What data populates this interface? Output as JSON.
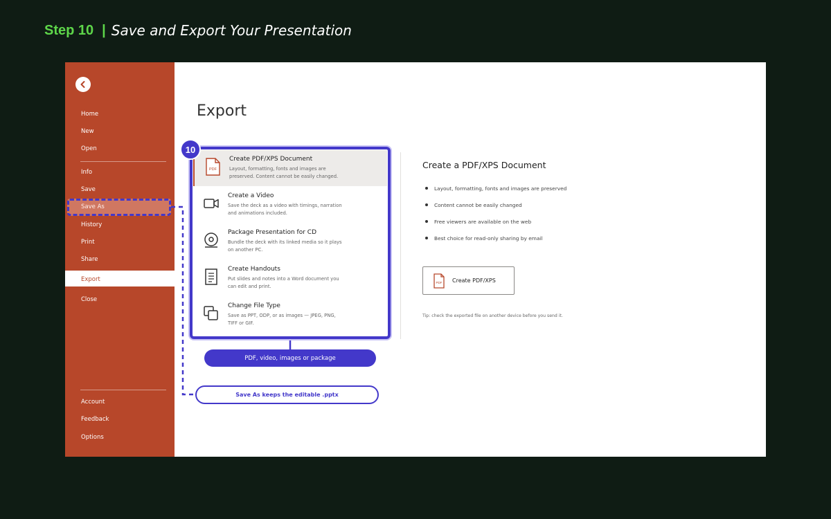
{
  "header": {
    "step_label": "Step 10",
    "separator": "|",
    "title": "Save and Export Your Presentation"
  },
  "sidebar": {
    "items_top": [
      "Home",
      "New",
      "Open"
    ],
    "items_mid": [
      "Info",
      "Save",
      "Save As",
      "History",
      "Print",
      "Share",
      "Export",
      "Close"
    ],
    "items_bottom": [
      "Account",
      "Feedback",
      "Options"
    ],
    "active": "Export"
  },
  "main": {
    "page_title": "Export",
    "options": [
      {
        "title": "Create PDF/XPS Document",
        "desc": "Layout, formatting, fonts and images are preserved. Content cannot be easily changed.",
        "icon": "pdf-icon",
        "selected": true
      },
      {
        "title": "Create a Video",
        "desc": "Save the deck as a video with timings, narration and animations included.",
        "icon": "video-camera-icon"
      },
      {
        "title": "Package Presentation for CD",
        "desc": "Bundle the deck with its linked media so it plays on another PC.",
        "icon": "disc-icon"
      },
      {
        "title": "Create Handouts",
        "desc": "Put slides and notes into a Word document you can edit and print.",
        "icon": "document-icon"
      },
      {
        "title": "Change File Type",
        "desc": "Save as PPT, ODP, or as images — JPEG, PNG, TIFF or GIF.",
        "icon": "copy-files-icon"
      }
    ]
  },
  "detail": {
    "title": "Create a PDF/XPS Document",
    "bullets": [
      "Layout, formatting, fonts and images are preserved",
      "Content cannot be easily changed",
      "Free viewers are available on the web",
      "Best choice for read-only sharing by email"
    ],
    "button_label": "Create PDF/XPS",
    "pdf_icon_text": "PDF",
    "tip": "Tip: check the exported file on another device before you send it."
  },
  "annotations": {
    "step_number": "10",
    "export_options_label": "PDF, video, images or package",
    "save_as_label": "Save As keeps the editable .pptx"
  },
  "colors": {
    "background": "#0f1c14",
    "step_accent": "#5ed64a",
    "sidebar": "#b7472a",
    "callout": "#4338ca"
  }
}
